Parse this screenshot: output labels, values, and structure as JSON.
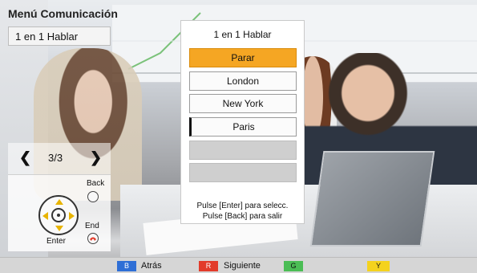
{
  "header": {
    "menu_title": "Menú Comunicación",
    "subtitle": "1 en 1 Hablar"
  },
  "pager": {
    "prev_icon": "chevron-left-icon",
    "next_icon": "chevron-right-icon",
    "count": "3/3"
  },
  "remote": {
    "back_label": "Back",
    "end_label": "End",
    "enter_label": "Enter",
    "arrow_color": "#e8b400"
  },
  "dialog": {
    "title": "1 en 1 Hablar",
    "options": [
      {
        "label": "Parar",
        "state": "highlighted"
      },
      {
        "label": "London",
        "state": "normal"
      },
      {
        "label": "New York",
        "state": "normal"
      },
      {
        "label": "Paris",
        "state": "marked"
      },
      {
        "label": "",
        "state": "empty"
      },
      {
        "label": "",
        "state": "empty"
      }
    ],
    "help_line1": "Pulse [Enter] para selecc.",
    "help_line2": "Pulse [Back] para salir",
    "highlight_color": "#f5a623"
  },
  "keybar": {
    "blue": {
      "key": "B",
      "label": "Atrás",
      "color": "#2f6fd6"
    },
    "red": {
      "key": "R",
      "label": "Siguiente",
      "color": "#e23b2a"
    },
    "green": {
      "key": "G",
      "label": "",
      "color": "#4bbd55"
    },
    "yellow": {
      "key": "Y",
      "label": "",
      "color": "#f4d21e"
    }
  }
}
